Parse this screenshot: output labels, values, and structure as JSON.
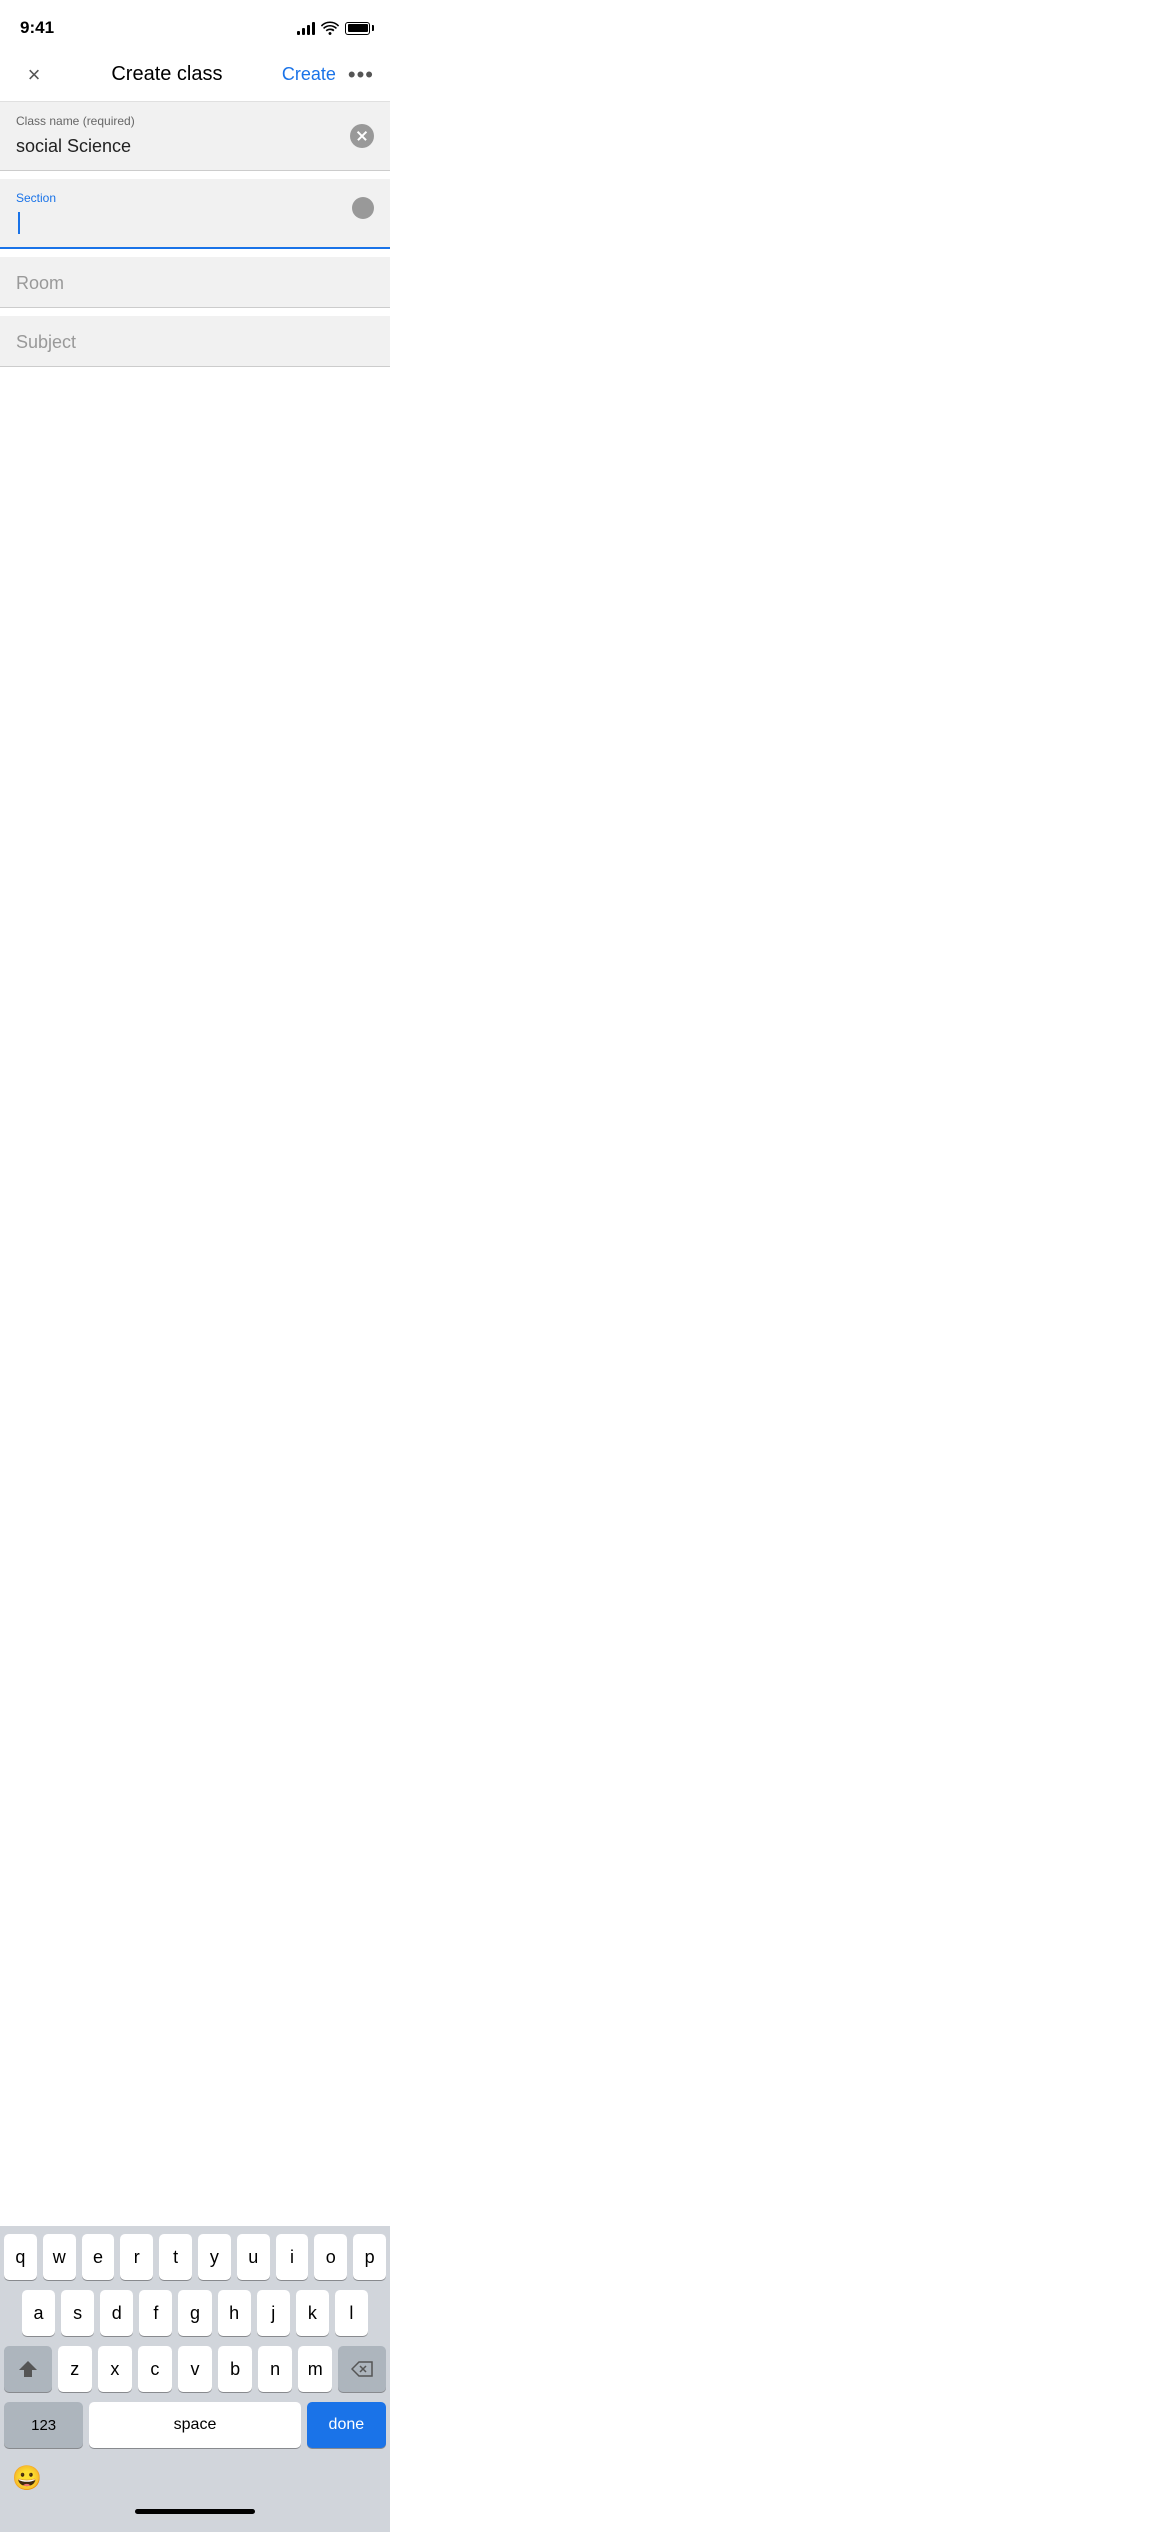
{
  "statusBar": {
    "time": "9:41"
  },
  "navBar": {
    "closeLabel": "×",
    "title": "Create class",
    "createLabel": "Create",
    "moreLabel": "•••"
  },
  "form": {
    "classNameLabel": "Class name (required)",
    "classNameValue": "social Science",
    "sectionLabel": "Section",
    "sectionValue": "",
    "roomLabel": "Room",
    "roomValue": "",
    "subjectLabel": "Subject",
    "subjectValue": ""
  },
  "keyboard": {
    "rows": [
      [
        "q",
        "w",
        "e",
        "r",
        "t",
        "y",
        "u",
        "i",
        "o",
        "p"
      ],
      [
        "a",
        "s",
        "d",
        "f",
        "g",
        "h",
        "j",
        "k",
        "l"
      ],
      [
        "z",
        "x",
        "c",
        "v",
        "b",
        "n",
        "m"
      ],
      [
        "123",
        "space",
        "done"
      ]
    ],
    "numLabel": "123",
    "spaceLabel": "space",
    "doneLabel": "done"
  }
}
